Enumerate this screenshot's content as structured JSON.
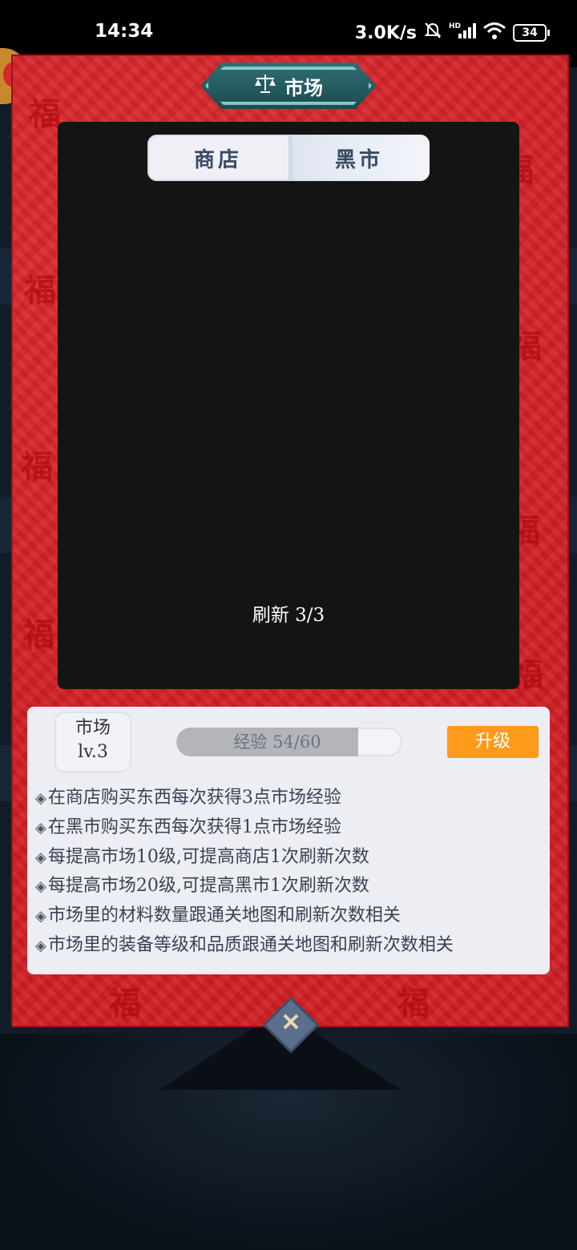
{
  "status_bar": {
    "time": "14:34",
    "network_speed": "3.0K/s",
    "battery": "34",
    "icons": [
      "mute-icon",
      "hd-signal-icon",
      "wifi-icon",
      "battery-icon"
    ]
  },
  "modal": {
    "title": "市场",
    "title_icon": "scale-icon",
    "tabs": [
      {
        "label": "商店",
        "active": false
      },
      {
        "label": "黑市",
        "active": true
      }
    ],
    "refresh_label": "刷新 3/3"
  },
  "market_info": {
    "name": "市场",
    "level": "lv.3",
    "xp_label": "经验 54/60",
    "xp_current": 54,
    "xp_max": 60,
    "upgrade_label": "升级",
    "tips": [
      "在商店购买东西每次获得3点市场经验",
      "在黑市购买东西每次获得1点市场经验",
      "每提高市场10级,可提高商店1次刷新次数",
      "每提高市场20级,可提高黑市1次刷新次数",
      "市场里的材料数量跟通关地图和刷新次数相关",
      "市场里的装备等级和品质跟通关地图和刷新次数相关"
    ],
    "tip_bullet": "◈"
  },
  "close_button_icon": "close-icon",
  "colors": {
    "modal_red": "#cf1e24",
    "plaque_teal": "#2f6e73",
    "upgrade_orange": "#ff9a1a",
    "panel_black": "#151414"
  }
}
